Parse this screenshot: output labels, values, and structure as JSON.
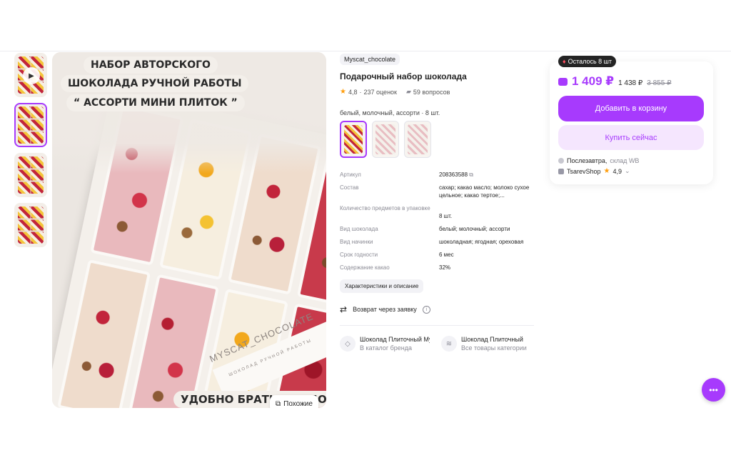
{
  "product": {
    "brand": "Myscat_chocolate",
    "title": "Подарочный набор шоколада",
    "rating": "4,8",
    "reviews": "237 оценок",
    "questions": "59 вопросов",
    "variant_label": "белый, молочный, ассорти · 8 шт."
  },
  "image": {
    "line1": "НАБОР АВТОРСКОГО",
    "line2": "ШОКОЛАДА РУЧНОЙ РАБОТЫ",
    "line3": "“ АССОРТИ МИНИ ПЛИТОК ”",
    "box_brand": "MYSCAT_CHOCOLATE",
    "box_sub": "ШОКОЛАД РУЧНОЙ РАБОТЫ",
    "bottom": "УДОБНО БРАТЬ С СОБОЙ",
    "similar": "Похожие"
  },
  "specs": [
    {
      "k": "Артикул",
      "v": "208363588"
    },
    {
      "k": "Состав",
      "v": "сахар; какао масло; молоко сухое цельное; какао тертое;..."
    },
    {
      "k": "Количество предметов в упаковке",
      "v": "8 шт."
    },
    {
      "k": "Вид шоколада",
      "v": "белый; молочный; ассорти"
    },
    {
      "k": "Вид начинки",
      "v": "шоколадная; ягодная; ореховая"
    },
    {
      "k": "Срок годности",
      "v": "6 мес"
    },
    {
      "k": "Содержание какао",
      "v": "32%"
    }
  ],
  "chars_button": "Характеристики и описание",
  "return_text": "Возврат через заявку",
  "categories": [
    {
      "title": "Шоколад Плиточный Myscat",
      "sub": "В каталог бренда"
    },
    {
      "title": "Шоколад Плиточный",
      "sub": "Все товары категории"
    }
  ],
  "buy": {
    "badge": "Осталось 8 шт",
    "price": "1 409 ₽",
    "price_old": "1 438 ₽",
    "price_crossed": "3 855 ₽",
    "cart_button": "Добавить в корзину",
    "buy_button": "Купить сейчас",
    "delivery": "Послезавтра,",
    "warehouse": "склад WB",
    "seller": "TsarevShop",
    "seller_rating": "4,9"
  },
  "colors": {
    "accent": "#a73afd",
    "accent_light": "#f5e6fe",
    "star": "#ff9e0d"
  }
}
